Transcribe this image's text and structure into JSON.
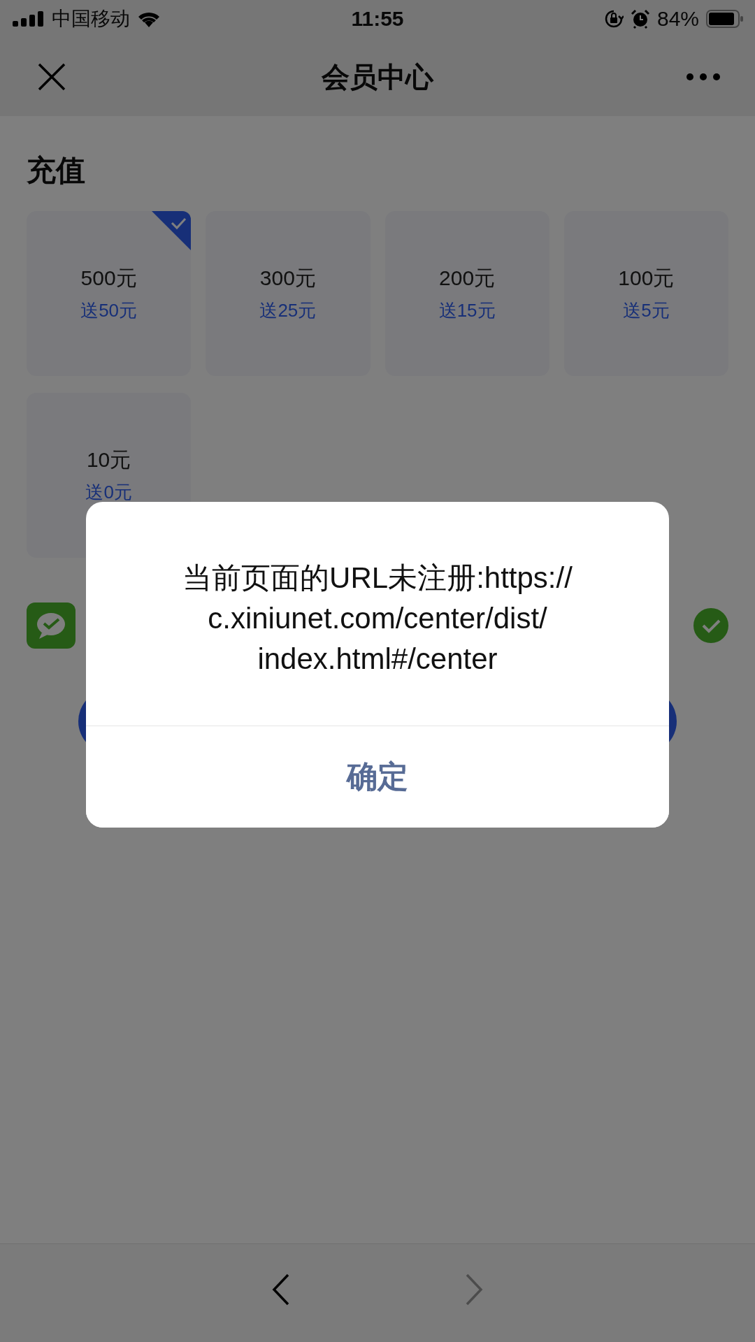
{
  "status_bar": {
    "carrier": "中国移动",
    "time": "11:55",
    "battery": "84%"
  },
  "nav": {
    "title": "会员中心"
  },
  "section_title": "充值",
  "options": [
    {
      "amount": "500元",
      "bonus": "送50元",
      "selected": true
    },
    {
      "amount": "300元",
      "bonus": "送25元",
      "selected": false
    },
    {
      "amount": "200元",
      "bonus": "送15元",
      "selected": false
    },
    {
      "amount": "100元",
      "bonus": "送5元",
      "selected": false
    },
    {
      "amount": "10元",
      "bonus": "送0元",
      "selected": false
    }
  ],
  "payment": {
    "checked": true
  },
  "dialog": {
    "message_lines": [
      "当前页面的URL未注册:https://",
      "c.xiniunet.com/center/dist/",
      "index.html#/center"
    ],
    "button": "确定"
  },
  "bottom_nav": [
    {
      "kind": "back",
      "disabled": false
    },
    {
      "kind": "forward",
      "disabled": true
    }
  ]
}
